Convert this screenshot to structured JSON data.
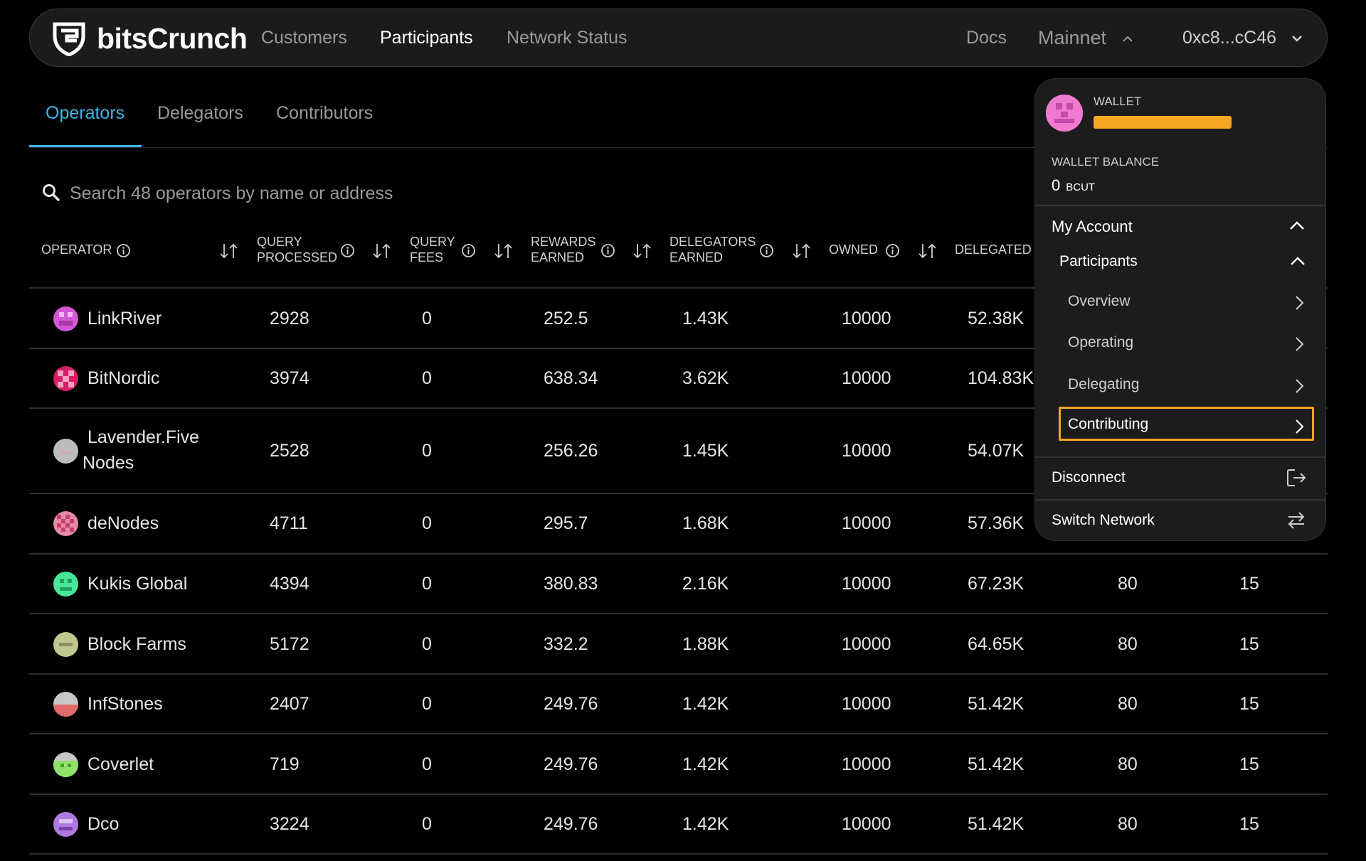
{
  "nav": {
    "brand": "bitsCrunch",
    "links": [
      "Customers",
      "Participants",
      "Network Status"
    ],
    "docs": "Docs",
    "network": "Mainnet",
    "wallet": "0xc8...cC46"
  },
  "tabs": [
    "Operators",
    "Delegators",
    "Contributors"
  ],
  "search": {
    "placeholder": "Search 48 operators by name or address"
  },
  "table": {
    "headers": [
      [
        "Operator"
      ],
      [
        "Query",
        "Processed"
      ],
      [
        "Query",
        "Fees"
      ],
      [
        "Rewards",
        "Earned"
      ],
      [
        "Delegators",
        "Earned"
      ],
      [
        "Owned"
      ],
      [
        "Delegated"
      ]
    ],
    "rows": [
      {
        "name": "LinkRiver",
        "processed": "2928",
        "fees": "0",
        "rewards": "252.5",
        "delegators": "1.43K",
        "owned": "10000",
        "delegated": "52.38K",
        "c8": "",
        "c9": "",
        "avatar": "#d357d6"
      },
      {
        "name": "BitNordic",
        "processed": "3974",
        "fees": "0",
        "rewards": "638.34",
        "delegators": "3.62K",
        "owned": "10000",
        "delegated": "104.83K",
        "c8": "",
        "c9": "",
        "avatar": "#d61f66"
      },
      {
        "name": "Lavender.Five Nodes",
        "name1": "Lavender.Five",
        "name2": "Nodes",
        "processed": "2528",
        "fees": "0",
        "rewards": "256.26",
        "delegators": "1.45K",
        "owned": "10000",
        "delegated": "54.07K",
        "c8": "",
        "c9": "",
        "avatar": "#bdbdbd"
      },
      {
        "name": "deNodes",
        "processed": "4711",
        "fees": "0",
        "rewards": "295.7",
        "delegators": "1.68K",
        "owned": "10000",
        "delegated": "57.36K",
        "c8": "",
        "c9": "",
        "avatar": "#e38aa6"
      },
      {
        "name": "Kukis Global",
        "processed": "4394",
        "fees": "0",
        "rewards": "380.83",
        "delegators": "2.16K",
        "owned": "10000",
        "delegated": "67.23K",
        "c8": "80",
        "c9": "15",
        "avatar": "#48e69a"
      },
      {
        "name": "Block Farms",
        "processed": "5172",
        "fees": "0",
        "rewards": "332.2",
        "delegators": "1.88K",
        "owned": "10000",
        "delegated": "64.65K",
        "c8": "80",
        "c9": "15",
        "avatar": "#c2c78f"
      },
      {
        "name": "InfStones",
        "processed": "2407",
        "fees": "0",
        "rewards": "249.76",
        "delegators": "1.42K",
        "owned": "10000",
        "delegated": "51.42K",
        "c8": "80",
        "c9": "15",
        "avatar": "#e16b6b"
      },
      {
        "name": "Coverlet",
        "processed": "719",
        "fees": "0",
        "rewards": "249.76",
        "delegators": "1.42K",
        "owned": "10000",
        "delegated": "51.42K",
        "c8": "80",
        "c9": "15",
        "avatar": "#8fe36a"
      },
      {
        "name": "Dco",
        "processed": "3224",
        "fees": "0",
        "rewards": "249.76",
        "delegators": "1.42K",
        "owned": "10000",
        "delegated": "51.42K",
        "c8": "80",
        "c9": "15",
        "avatar": "#b07ae0"
      }
    ]
  },
  "dropdown": {
    "wallet_label": "Wallet",
    "balance_label": "Wallet Balance",
    "balance_value": "0",
    "balance_unit": "BCUT",
    "my_account": "My Account",
    "participants": "Participants",
    "items": [
      "Overview",
      "Operating",
      "Delegating",
      "Contributing"
    ],
    "disconnect": "Disconnect",
    "switch_network": "Switch Network"
  },
  "colors": {
    "accent": "#3fb4e3",
    "highlight": "#f5a623",
    "background": "#000000",
    "navbar": "#1b1b1b"
  }
}
